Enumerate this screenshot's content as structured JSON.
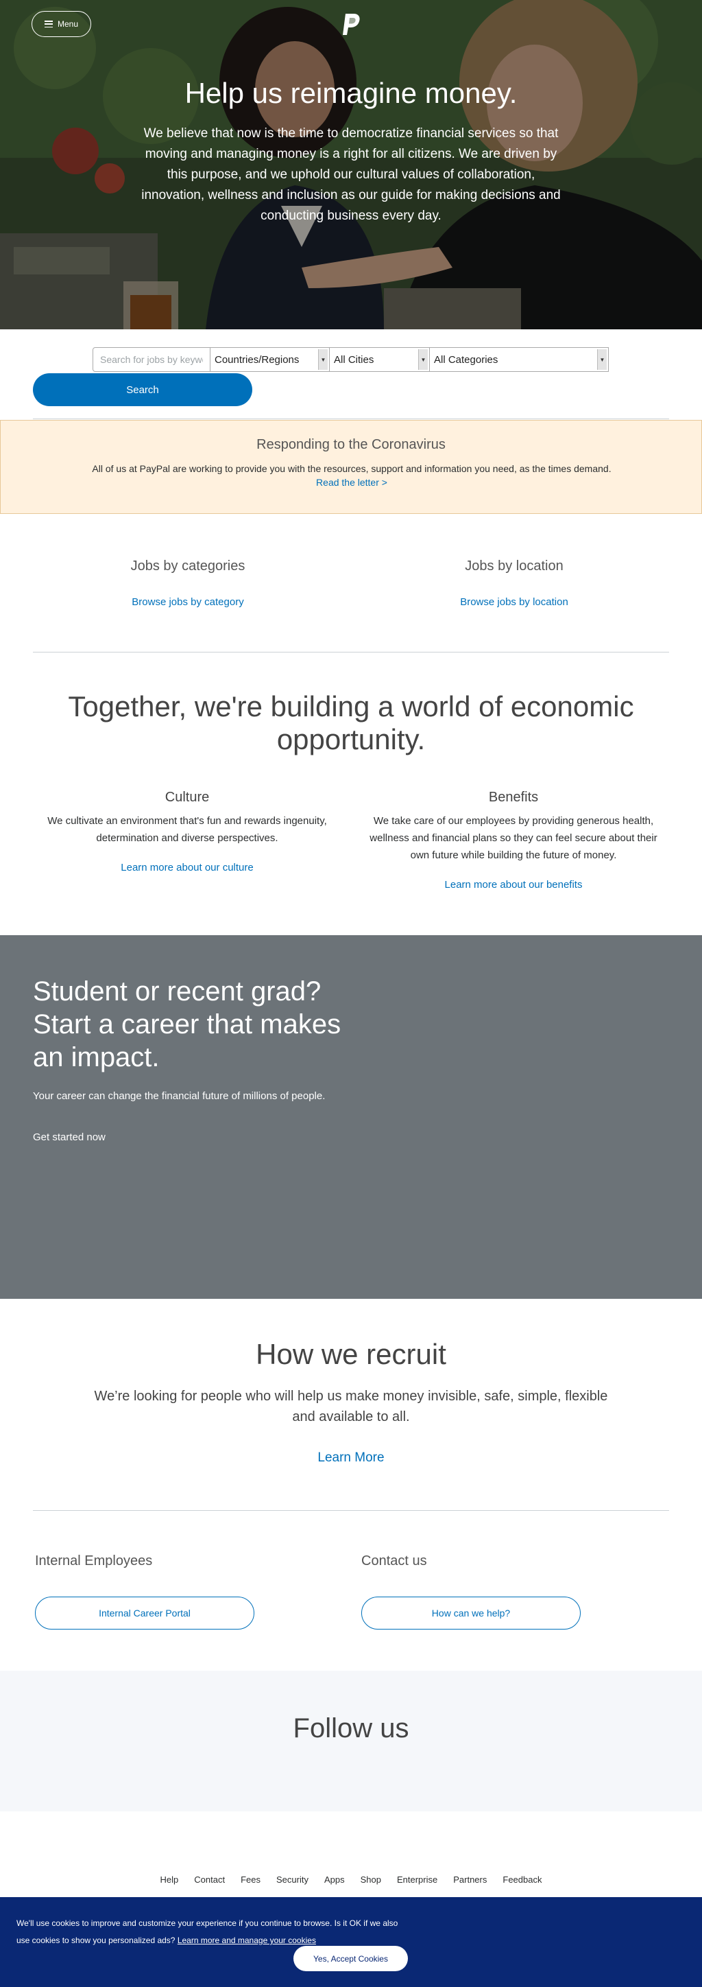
{
  "header": {
    "menu_label": "Menu",
    "logo_icon": "paypal-logo-icon"
  },
  "hero": {
    "title": "Help us reimagine money.",
    "text": "We believe that now is the time to democratize financial services so that moving and managing money is a right for all citizens. We are driven by this purpose, and we uphold our cultural values of collaboration, innovation, wellness and inclusion as our guide for making decisions and conducting business every day."
  },
  "search": {
    "keyword_placeholder": "Search for jobs by keyword",
    "countries_value": "Countries/Regions",
    "cities_value": "All Cities",
    "categories_value": "All Categories",
    "button_label": "Search"
  },
  "coronavirus": {
    "title": "Responding to the Coronavirus",
    "text": "All of us at PayPal are working to provide you with the resources, support and information you need, as the times demand.",
    "link": "Read the letter >"
  },
  "jobs_by": {
    "category_title": "Jobs by categories",
    "category_link": "Browse jobs by category",
    "location_title": "Jobs by location",
    "location_link": "Browse jobs by location"
  },
  "together": {
    "title": "Together, we're building a world of economic opportunity.",
    "culture_title": "Culture",
    "culture_text": "We cultivate an environment that's fun and rewards ingenuity, determination and diverse perspectives.",
    "culture_link": "Learn more about our culture",
    "benefits_title": "Benefits",
    "benefits_text": "We take care of our employees by providing generous health, wellness and financial plans so they can feel secure about their own future while building the future of money.",
    "benefits_link": "Learn more about our benefits"
  },
  "student": {
    "title": "Student or recent grad? Start a career that makes an impact.",
    "text": "Your career can change the financial future of millions of people.",
    "link": "Get started now"
  },
  "recruit": {
    "title": "How we recruit",
    "text": "We’re looking for people who will help us make money invisible, safe, simple, flexible and available to all.",
    "link": "Learn More"
  },
  "employees": {
    "internal_title": "Internal Employees",
    "internal_button": "Internal Career Portal",
    "contact_title": "Contact us",
    "contact_button": "How can we help?"
  },
  "follow": {
    "title": "Follow us"
  },
  "footer": {
    "links": [
      "Help",
      "Contact",
      "Fees",
      "Security",
      "Apps",
      "Shop",
      "Enterprise",
      "Partners",
      "Feedback"
    ]
  },
  "cookie": {
    "text": "We'll use cookies to improve and customize your experience if you continue to browse. Is it OK if we also use cookies to show you personalized ads?",
    "link": "Learn more and manage your cookies",
    "button": "Yes, Accept Cookies"
  },
  "colors": {
    "brand_blue": "#0070ba",
    "student_bg": "#6c7378",
    "cookie_bg": "#0a2874",
    "notice_bg": "#fff1de"
  }
}
